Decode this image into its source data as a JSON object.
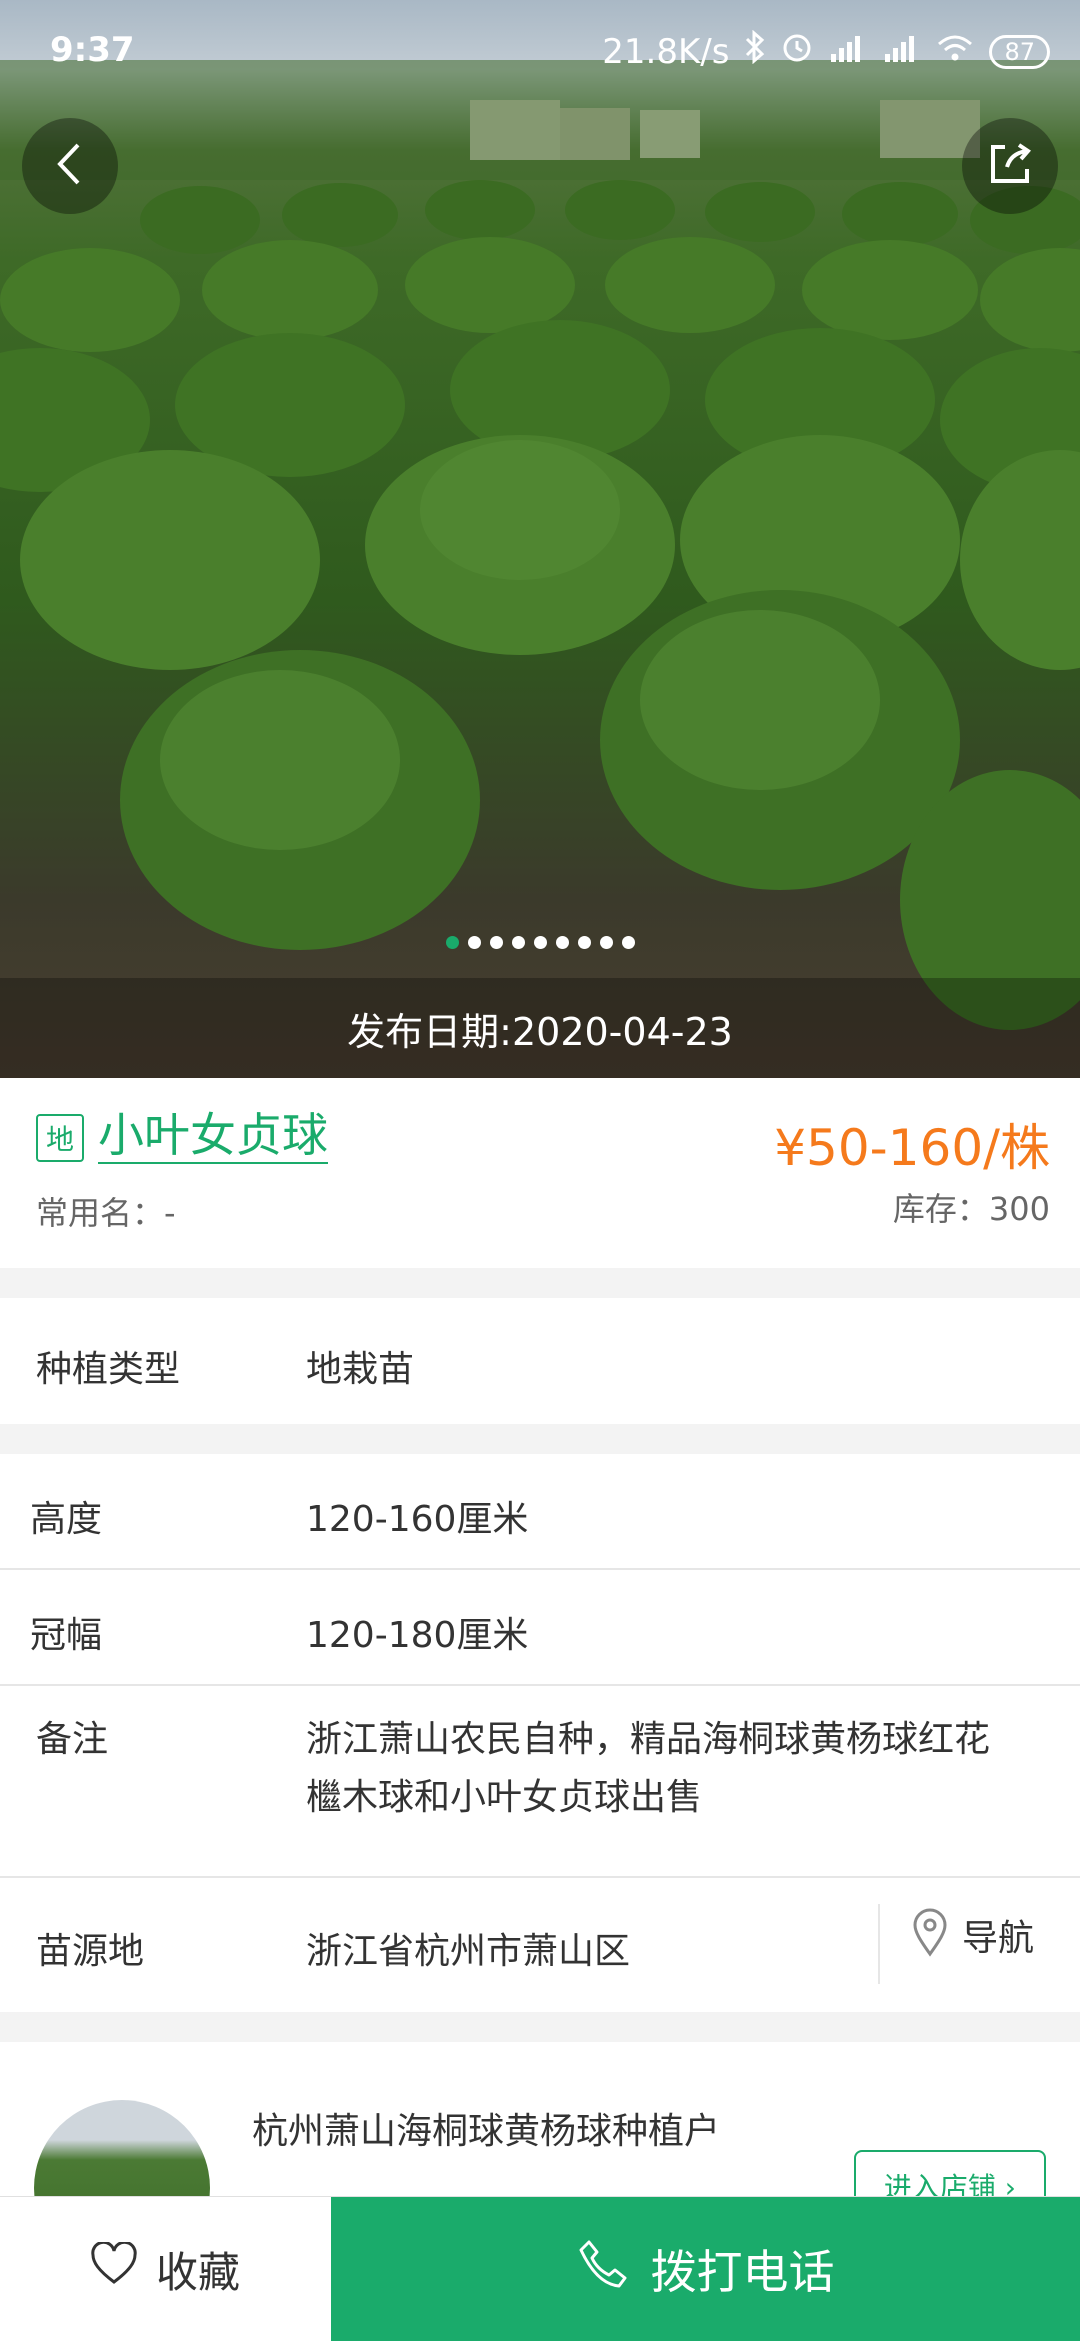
{
  "status_bar": {
    "time": "9:37",
    "network_speed": "21.8K/s",
    "battery": "87",
    "icons": [
      "bluetooth-icon",
      "alarm-icon",
      "signal-hd-icon",
      "signal-hd-icon",
      "wifi-icon",
      "battery-icon"
    ]
  },
  "hero": {
    "image_dots_count": 9,
    "active_dot": 0,
    "publish_date": "发布日期:2020-04-23"
  },
  "product": {
    "tag": "地",
    "name": "小叶女贞球",
    "price": "¥50-160/株",
    "common_name": "常用名：-",
    "stock": "库存：300"
  },
  "attributes": {
    "planting_type": {
      "label": "种植类型",
      "value": "地栽苗"
    },
    "height": {
      "label": "高度",
      "value": "120-160厘米"
    },
    "crown": {
      "label": "冠幅",
      "value": "120-180厘米"
    },
    "note": {
      "label": "备注",
      "value_line1": "浙江萧山农民自种，精品海桐球黄杨球红花",
      "value_line2": "檵木球和小叶女贞球出售"
    },
    "origin": {
      "label": "苗源地",
      "value": "浙江省杭州市萧山区",
      "nav_label": "导航"
    }
  },
  "store": {
    "name": "杭州萧山海桐球黄杨球种植户",
    "enter_label": "进入店铺"
  },
  "bottom_bar": {
    "favorite_label": "收藏",
    "call_label": "拨打电话"
  },
  "colors": {
    "accent": "#1aab6b",
    "price": "#f57a1c"
  }
}
